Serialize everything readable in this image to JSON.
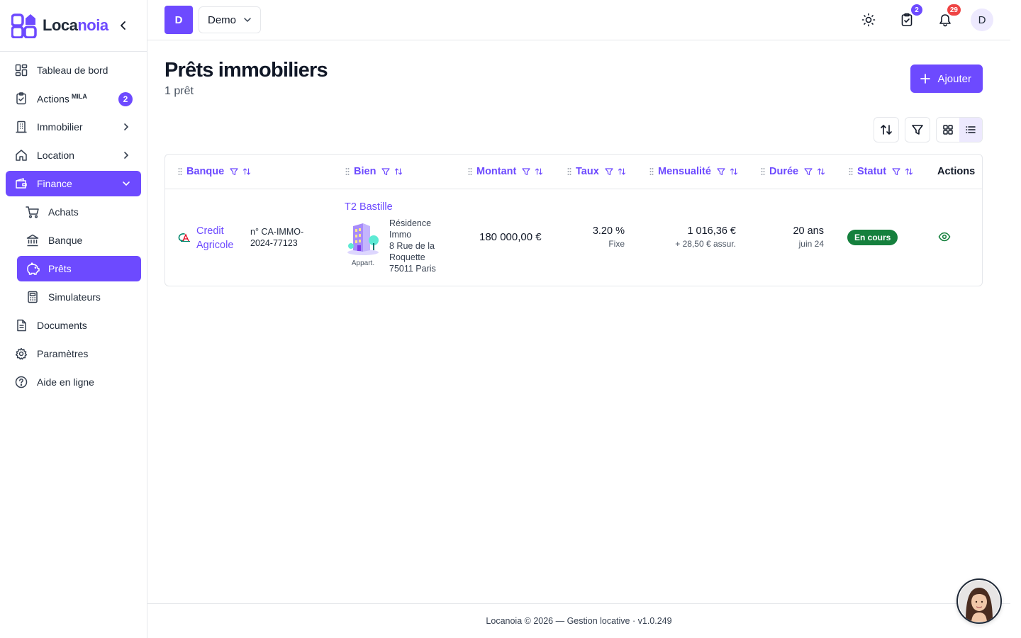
{
  "app": {
    "logo_prefix": "Loca",
    "logo_suffix": "noia",
    "brand_color": "#6d4aff"
  },
  "sidebar": {
    "items": [
      {
        "label": "Tableau de bord",
        "icon": "dashboard-icon"
      },
      {
        "label": "Actions",
        "sup": "MILA",
        "badge": "2",
        "icon": "clipboard-check-icon"
      },
      {
        "label": "Immobilier",
        "icon": "building-icon"
      },
      {
        "label": "Location",
        "icon": "home-icon"
      },
      {
        "label": "Finance",
        "icon": "wallet-icon",
        "expanded": true
      },
      {
        "label": "Achats",
        "icon": "cart-icon"
      },
      {
        "label": "Banque",
        "icon": "bank-icon"
      },
      {
        "label": "Prêts",
        "icon": "piggy-bank-icon",
        "active": true
      },
      {
        "label": "Simulateurs",
        "icon": "calculator-icon"
      },
      {
        "label": "Documents",
        "icon": "document-icon"
      },
      {
        "label": "Paramètres",
        "icon": "gear-icon"
      },
      {
        "label": "Aide en ligne",
        "icon": "help-circle-icon"
      }
    ]
  },
  "topbar": {
    "workspace_initial": "D",
    "workspace_name": "Demo",
    "tasks_badge": "2",
    "notifications_badge": "29",
    "user_initial": "D",
    "badge_colors": {
      "tasks": "#6d4aff",
      "notifications": "#ef4444"
    }
  },
  "page": {
    "title": "Prêts immobiliers",
    "subtitle": "1 prêt",
    "add_label": "Ajouter"
  },
  "table": {
    "columns": [
      "Banque",
      "Bien",
      "Montant",
      "Taux",
      "Mensualité",
      "Durée",
      "Statut",
      "Actions"
    ],
    "rows": [
      {
        "bank_line1": "Credit",
        "bank_line2": "Agricole",
        "loan_number_line1": "n° CA-IMMO-",
        "loan_number_line2": "2024-77123",
        "property_name": "T2 Bastille",
        "property_type": "Appart.",
        "address_lines": [
          "Résidence",
          "Immo",
          "8 Rue de la",
          "Roquette",
          "75011 Paris"
        ],
        "amount": "180 000,00 €",
        "rate": "3.20 %",
        "rate_type": "Fixe",
        "monthly": "1 016,36 €",
        "insurance": "+ 28,50 € assur.",
        "duration": "20 ans",
        "start": "juin 24",
        "status": "En cours",
        "status_color": "#15803d"
      }
    ]
  },
  "footer": {
    "text": "Locanoia © 2026 — Gestion locative · v1.0.249"
  }
}
